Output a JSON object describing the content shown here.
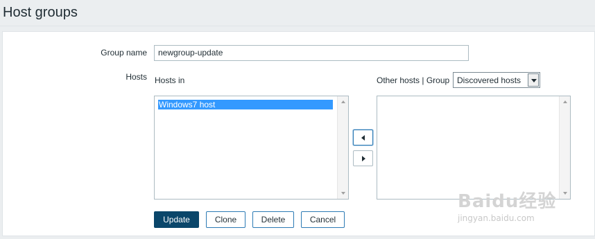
{
  "header": {
    "title": "Host groups"
  },
  "form": {
    "group_name_label": "Group name",
    "group_name_value": "newgroup-update",
    "hosts_label": "Hosts",
    "hosts_in_label": "Hosts in",
    "hosts_in_items": [
      "Windows7 host"
    ],
    "other_hosts_label": "Other hosts | Group",
    "group_select_value": "Discovered hosts"
  },
  "buttons": {
    "update": "Update",
    "clone": "Clone",
    "delete": "Delete",
    "cancel": "Cancel"
  },
  "icons": {
    "move_left": "triangle-left-icon",
    "move_right": "triangle-right-icon",
    "dropdown": "chevron-down-icon"
  },
  "colors": {
    "primary_button": "#0a466a",
    "selection": "#3399ff",
    "background": "#ebeef0"
  },
  "watermark": {
    "logo_text": "Baidu经验",
    "url": "jingyan.baidu.com"
  }
}
